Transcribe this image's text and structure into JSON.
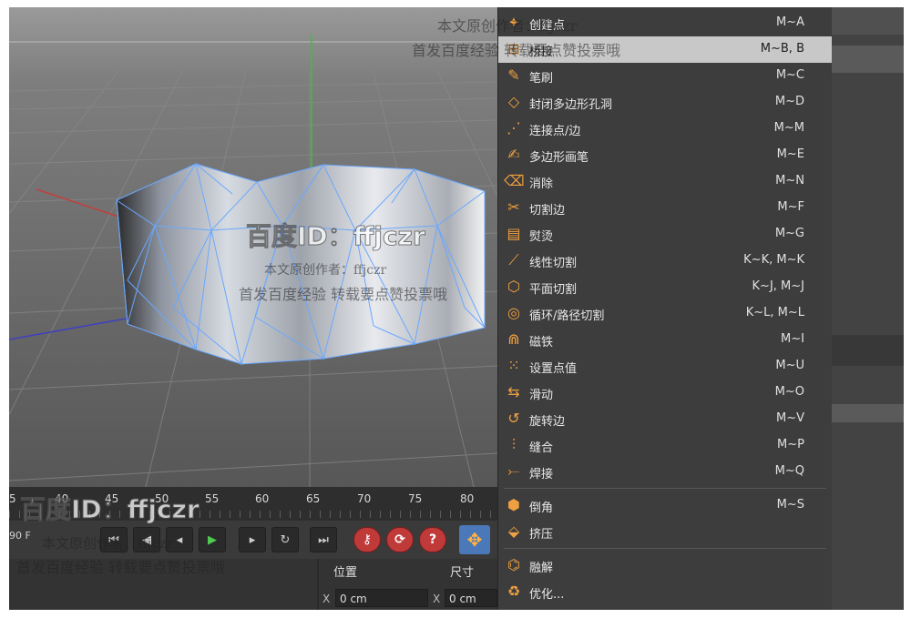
{
  "menu": {
    "items": [
      {
        "label": "创建点",
        "shortcut": "M~A",
        "icon": "create-point-icon"
      },
      {
        "label": "桥接",
        "shortcut": "M~B, B",
        "icon": "bridge-icon",
        "highlighted": true
      },
      {
        "label": "笔刷",
        "shortcut": "M~C",
        "icon": "brush-icon"
      },
      {
        "label": "封闭多边形孔洞",
        "shortcut": "M~D",
        "icon": "close-hole-icon"
      },
      {
        "label": "连接点/边",
        "shortcut": "M~M",
        "icon": "connect-icon"
      },
      {
        "label": "多边形画笔",
        "shortcut": "M~E",
        "icon": "polygon-pen-icon"
      },
      {
        "label": "消除",
        "shortcut": "M~N",
        "icon": "dissolve-icon"
      },
      {
        "label": "切割边",
        "shortcut": "M~F",
        "icon": "cut-edge-icon"
      },
      {
        "label": "熨烫",
        "shortcut": "M~G",
        "icon": "iron-icon"
      },
      {
        "label": "线性切割",
        "shortcut": "K~K, M~K",
        "icon": "knife-icon"
      },
      {
        "label": "平面切割",
        "shortcut": "K~J, M~J",
        "icon": "plane-cut-icon"
      },
      {
        "label": "循环/路径切割",
        "shortcut": "K~L, M~L",
        "icon": "loop-cut-icon"
      },
      {
        "label": "磁铁",
        "shortcut": "M~I",
        "icon": "magnet-icon"
      },
      {
        "label": "设置点值",
        "shortcut": "M~U",
        "icon": "set-point-icon"
      },
      {
        "label": "滑动",
        "shortcut": "M~O",
        "icon": "slide-icon"
      },
      {
        "label": "旋转边",
        "shortcut": "M~V",
        "icon": "spin-edge-icon"
      },
      {
        "label": "缝合",
        "shortcut": "M~P",
        "icon": "stitch-icon"
      },
      {
        "label": "焊接",
        "shortcut": "M~Q",
        "icon": "weld-icon"
      }
    ],
    "items2": [
      {
        "label": "倒角",
        "shortcut": "M~S",
        "icon": "bevel-icon"
      },
      {
        "label": "挤压",
        "shortcut": "",
        "icon": "extrude-icon"
      }
    ],
    "items3": [
      {
        "label": "融解",
        "shortcut": "",
        "icon": "melt-icon"
      },
      {
        "label": "优化...",
        "shortcut": "",
        "icon": "optimize-icon"
      }
    ]
  },
  "timeline": {
    "ticks": [
      "5",
      "40",
      "45",
      "50",
      "55",
      "60",
      "65",
      "70",
      "75",
      "80"
    ],
    "frame_field": "90 F"
  },
  "coords": {
    "position_label": "位置",
    "size_label": "尺寸",
    "x_axis": "X",
    "x_value": "0 cm",
    "x_axis2": "X",
    "x_value2": "0 cm"
  },
  "watermark": {
    "id_text": "百度ID：ffjczr",
    "author": "本文原创作者：ffjczr",
    "notice": "首发百度经验  转载要点赞投票哦"
  },
  "colors": {
    "accent_blue": "#4a78b8",
    "record_red": "#c03a3a",
    "play_green": "#4ecb4e",
    "menu_highlight": "#c8c8c8"
  }
}
